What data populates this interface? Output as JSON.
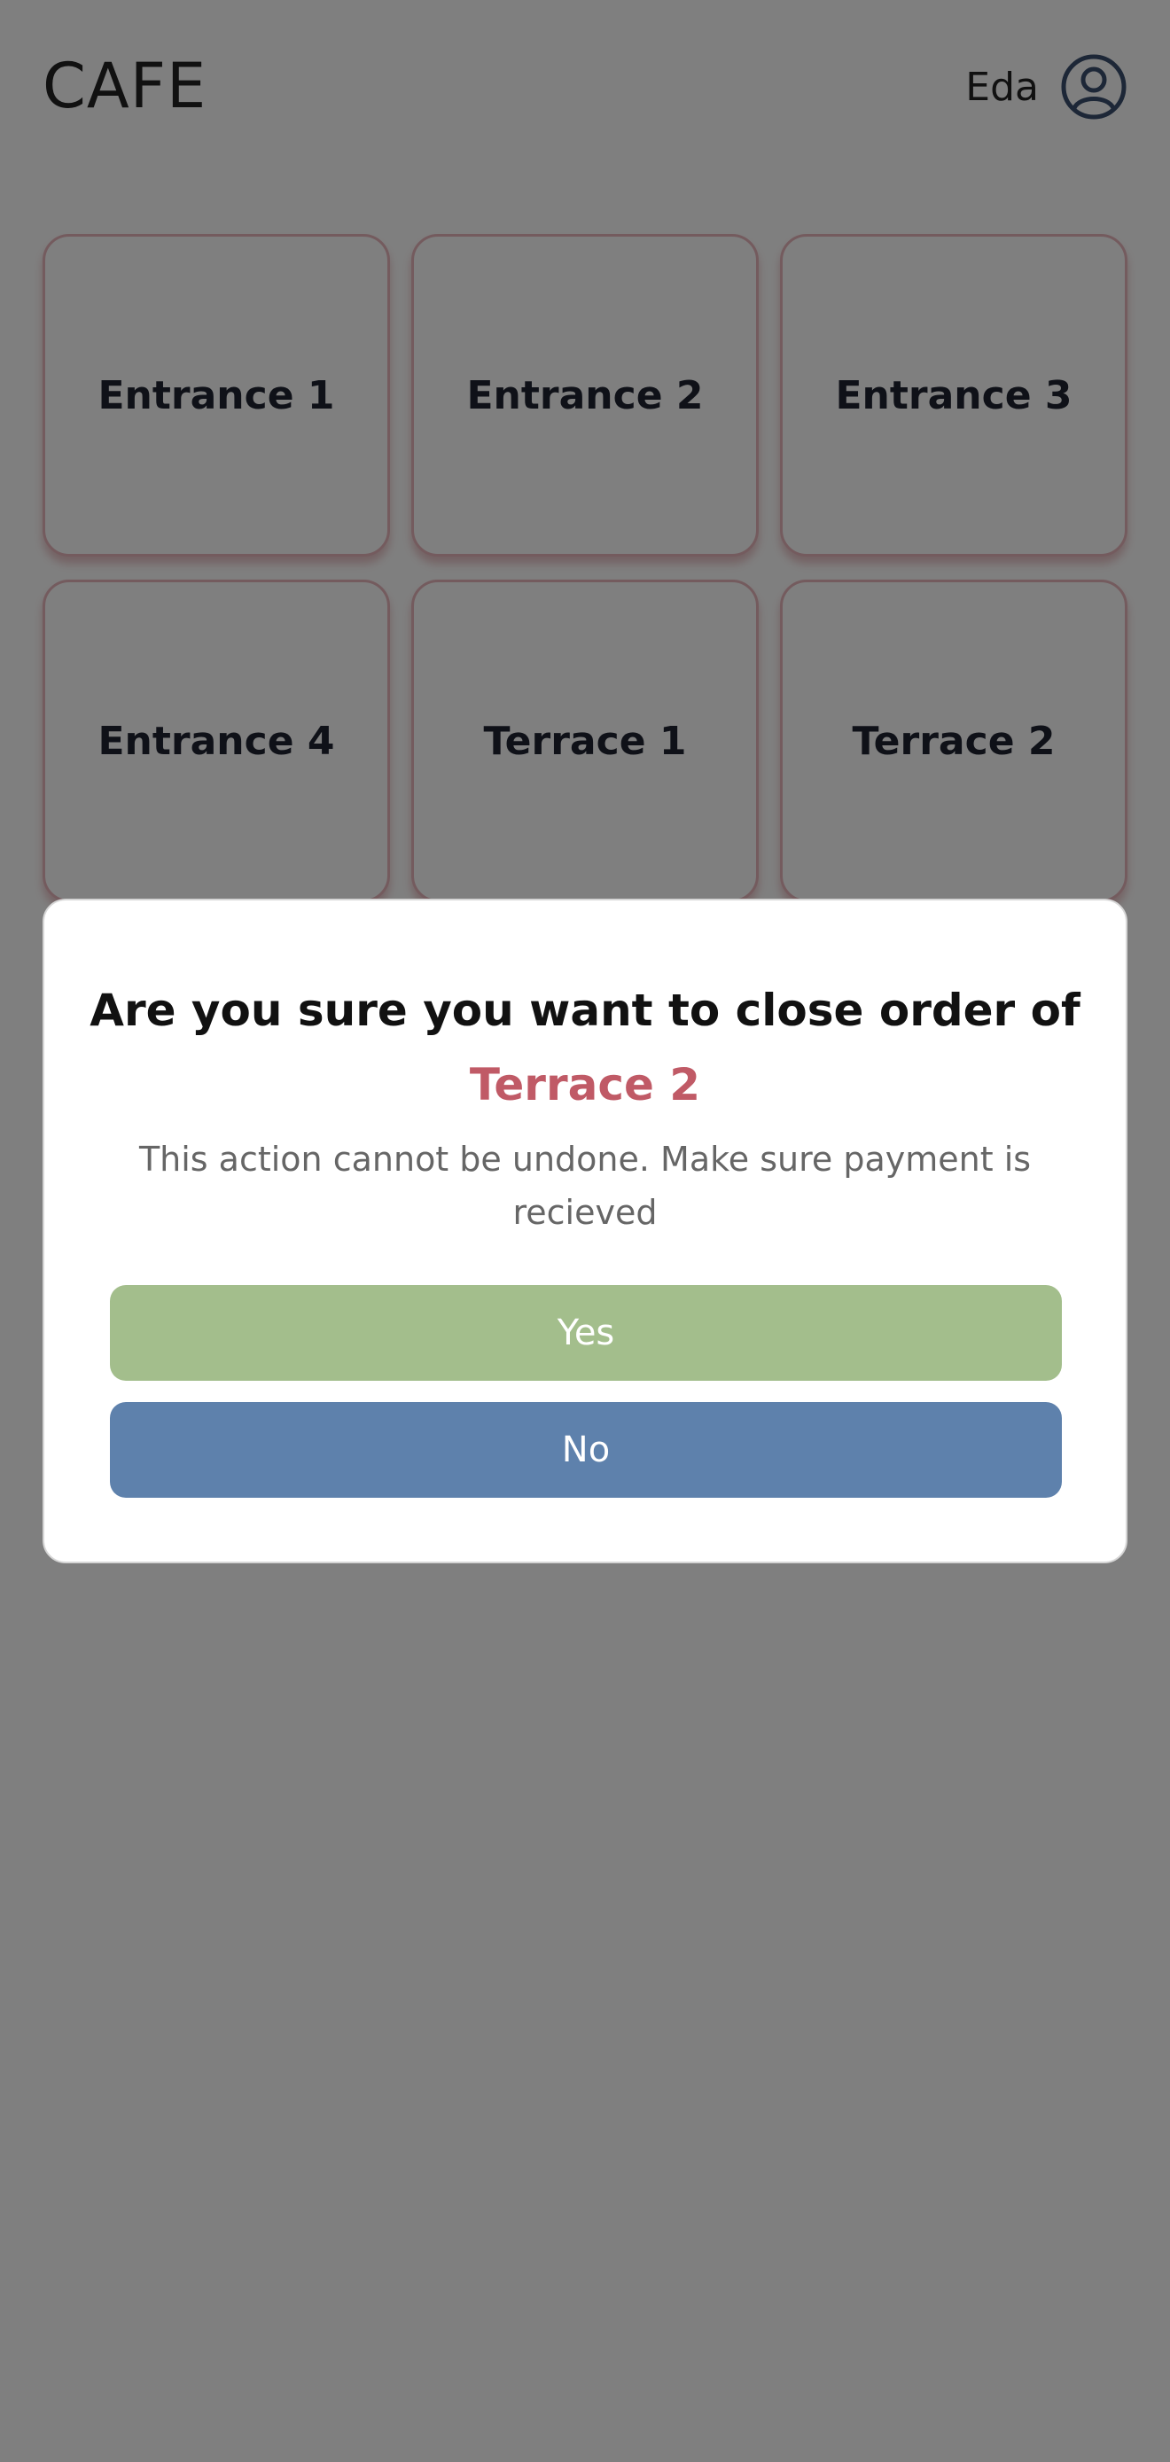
{
  "header": {
    "brand": "CAFE",
    "user_name": "Eda",
    "user_icon": "account-circle-icon"
  },
  "tables": [
    {
      "label": "Entrance 1"
    },
    {
      "label": "Entrance 2"
    },
    {
      "label": "Entrance 3"
    },
    {
      "label": "Entrance 4"
    },
    {
      "label": "Terrace 1"
    },
    {
      "label": "Terrace 2"
    }
  ],
  "modal": {
    "title": "Are you sure you want to close order of",
    "table_name": "Terrace 2",
    "message": "This action cannot be undone. Make sure payment is recieved",
    "yes_label": "Yes",
    "no_label": "No"
  },
  "colors": {
    "accent": "#c05a66",
    "yes": "#a3be8c",
    "no": "#5e81ac",
    "avatar": "#3b4f6e"
  }
}
